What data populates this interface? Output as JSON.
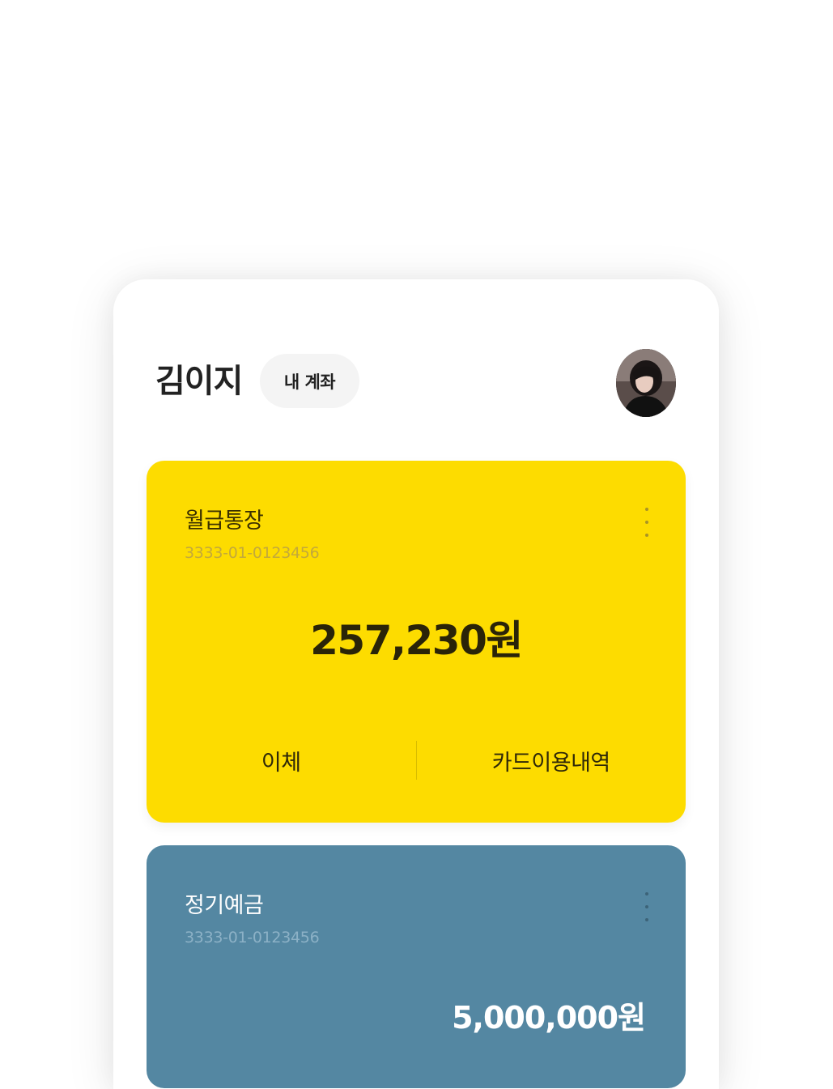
{
  "header": {
    "user_name": "김이지",
    "accounts_chip": "내 계좌"
  },
  "accounts": [
    {
      "name": "월급통장",
      "number": "3333-01-0123456",
      "balance": "257,230원",
      "actions": [
        "이체",
        "카드이용내역"
      ],
      "color": "#fddc00"
    },
    {
      "name": "정기예금",
      "number": "3333-01-0123456",
      "balance": "5,000,000원",
      "color": "#5487a2"
    }
  ],
  "icons": {
    "avatar": "profile-photo",
    "more": "vertical-dots-icon"
  }
}
